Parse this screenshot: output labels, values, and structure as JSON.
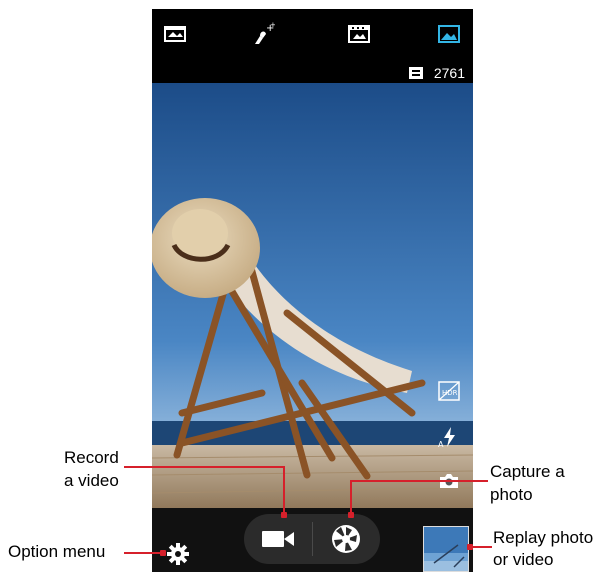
{
  "top_modes": [
    {
      "icon": "panorama-icon",
      "active": false
    },
    {
      "icon": "beauty-magic-icon",
      "active": false
    },
    {
      "icon": "video-mode-icon",
      "active": false
    },
    {
      "icon": "photo-mode-icon",
      "active": true
    }
  ],
  "storage": {
    "icon": "sd-card-icon",
    "remaining": "2761"
  },
  "viewfinder": {
    "scene": "beach-chair-with-straw-hat-photo"
  },
  "side_controls": [
    {
      "icon": "hdr-icon"
    },
    {
      "icon": "auto-flash-icon"
    },
    {
      "icon": "switch-camera-icon"
    }
  ],
  "bottom": {
    "record_icon": "video-camera-icon",
    "capture_icon": "shutter-aperture-icon",
    "settings_icon": "gear-icon",
    "thumbnail": "last-capture-thumbnail"
  },
  "callouts": {
    "record_line1": "Record",
    "record_line2": "a video",
    "capture_line1": "Capture  a",
    "capture_line2": "photo",
    "option_menu": "Option menu",
    "replay_line1": "Replay photo",
    "replay_line2": "or video"
  },
  "colors": {
    "accent": "#33b5e5",
    "callout_line": "#d6202b",
    "sky_top": "#1d4f8c",
    "sea": "#1a3f6b"
  }
}
